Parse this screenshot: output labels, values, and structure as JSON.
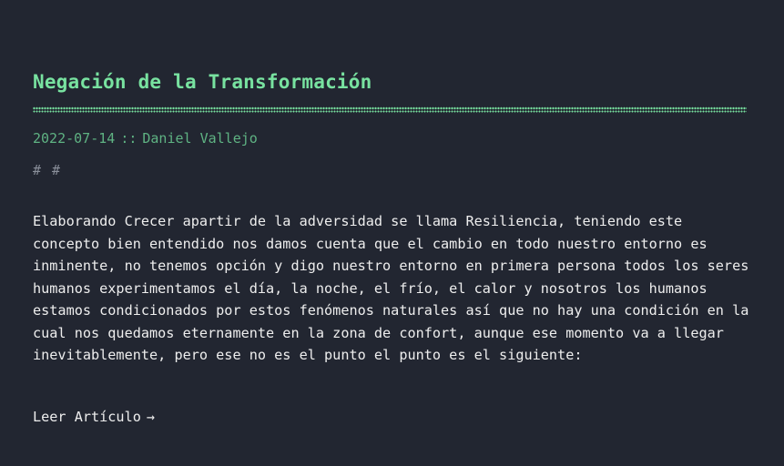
{
  "post": {
    "title": "Negación de la Transformación",
    "date": "2022-07-14",
    "meta_separator": "::",
    "author": "Daniel Vallejo",
    "tags": [
      "#",
      "#"
    ],
    "excerpt": "Elaborando Crecer apartir de la adversidad se llama Resiliencia, teniendo este concepto bien entendido nos damos cuenta que el cambio en todo nuestro entorno es inminente, no tenemos opción y digo nuestro entorno en primera persona todos los seres humanos experimentamos el día, la noche, el frío, el calor y nosotros los humanos estamos condicionados por estos fenómenos naturales así que no hay una condición en la cual nos quedamos eternamente en la zona de confort, aunque ese momento va a llegar inevitablemente, pero ese no es el punto el punto es el siguiente:",
    "read_more_label": "Leer Artículo",
    "read_more_arrow": "→"
  },
  "colors": {
    "background": "#222631",
    "accent": "#78e2a0",
    "meta": "#5fb383",
    "text": "#eeeeee",
    "tag": "#8a8f9a"
  }
}
